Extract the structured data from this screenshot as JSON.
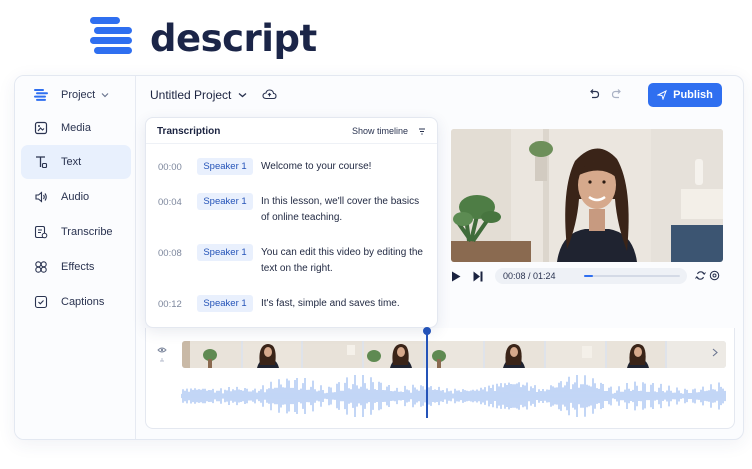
{
  "brand": {
    "name": "descript",
    "icon": "descript-logo-icon",
    "color": "#2f6ff0"
  },
  "sidebar": {
    "items": [
      {
        "label": "Project",
        "icon": "project-icon",
        "has_caret": true
      },
      {
        "label": "Media",
        "icon": "media-icon"
      },
      {
        "label": "Text",
        "icon": "text-icon",
        "active": true
      },
      {
        "label": "Audio",
        "icon": "audio-icon"
      },
      {
        "label": "Transcribe",
        "icon": "transcribe-icon"
      },
      {
        "label": "Effects",
        "icon": "effects-icon"
      },
      {
        "label": "Captions",
        "icon": "captions-icon"
      }
    ]
  },
  "toolbar": {
    "project_title": "Untitled Project",
    "publish_label": "Publish",
    "accent": "#2f6ff0"
  },
  "transcription": {
    "title": "Transcription",
    "show_timeline_label": "Show timeline",
    "rows": [
      {
        "time": "00:00",
        "speaker": "Speaker 1",
        "text": "Welcome to your course!"
      },
      {
        "time": "00:04",
        "speaker": "Speaker 1",
        "text": "In this lesson, we'll cover the basics of online teaching."
      },
      {
        "time": "00:08",
        "speaker": "Speaker 1",
        "text": "You can edit this video by editing the text on the right."
      },
      {
        "time": "00:12",
        "speaker": "Speaker 1",
        "text": "It's fast, simple and saves time."
      }
    ]
  },
  "player": {
    "time_readout": "00:08 / 01:24",
    "progress_fraction": 0.095
  },
  "timeline": {
    "playhead_fraction": 0.45
  }
}
